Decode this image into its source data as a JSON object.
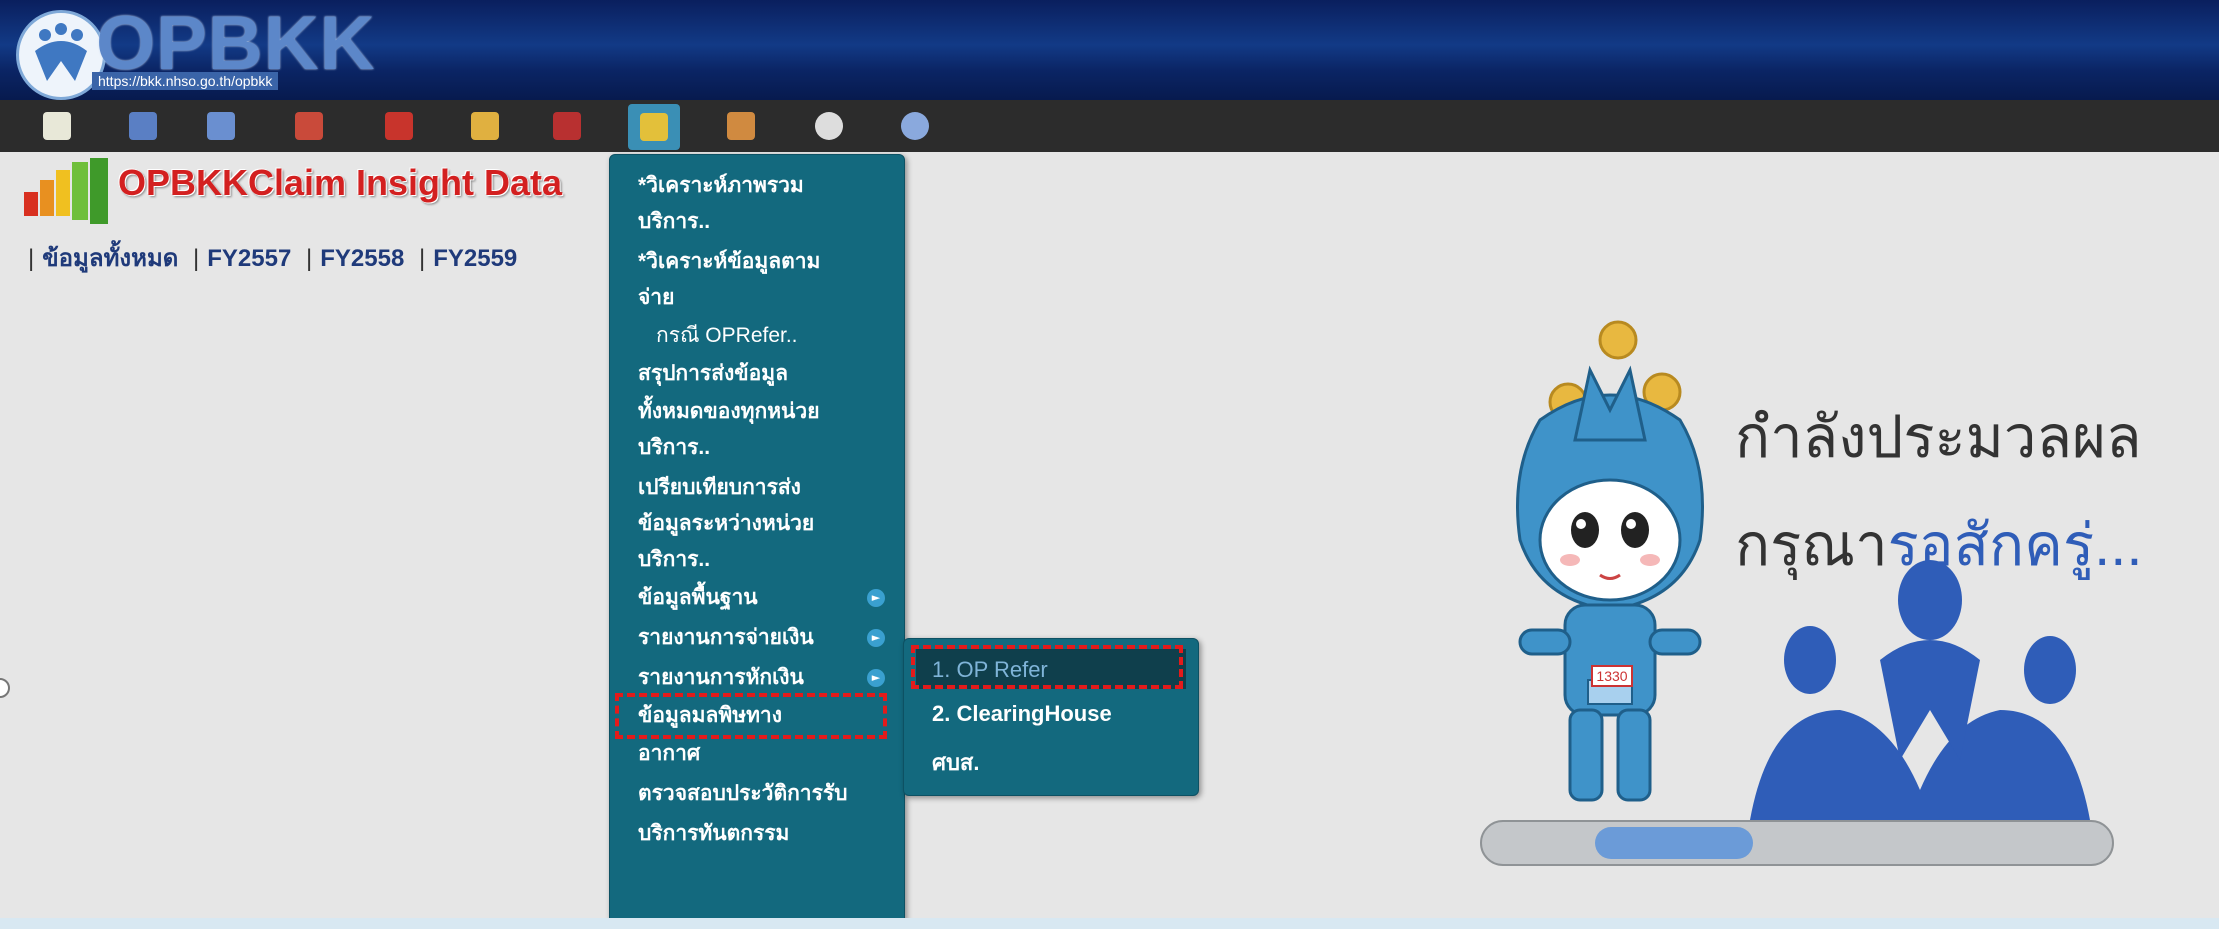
{
  "header": {
    "logo_text": "OPBKK",
    "logo_url": "https://bkk.nhso.go.th/opbkk"
  },
  "toolbar": {
    "icons": [
      {
        "name": "chart-icon",
        "color": "#e8e8d8"
      },
      {
        "name": "document-icon",
        "color": "#5a7fc4"
      },
      {
        "name": "search-icon",
        "color": "#6a8fd0"
      },
      {
        "name": "book-icon",
        "color": "#c94a3a"
      },
      {
        "name": "magnifier-icon",
        "color": "#c8342c"
      },
      {
        "name": "star-icon",
        "color": "#e0b040"
      },
      {
        "name": "box-icon",
        "color": "#b83030"
      },
      {
        "name": "report-icon",
        "color": "#e3c03a"
      },
      {
        "name": "users-icon",
        "color": "#d08a40"
      },
      {
        "name": "gear-icon",
        "color": "#dddddd"
      },
      {
        "name": "power-icon",
        "color": "#8aa9dd"
      }
    ]
  },
  "main": {
    "insight_title": "OPBKKClaim Insight Data",
    "fy_nav": [
      "ข้อมูลทั้งหมด",
      "FY2557",
      "FY2558",
      "FY2559"
    ]
  },
  "menu": {
    "items": [
      {
        "label": "*วิเคราะห์ภาพรวม"
      },
      {
        "label": "บริการ.."
      },
      {
        "label": "*วิเคราะห์ข้อมูลตาม"
      },
      {
        "label": "จ่าย"
      },
      {
        "label": "กรณี OPRefer.."
      },
      {
        "label": "สรุปการส่งข้อมูล"
      },
      {
        "label": "ทั้งหมดของทุกหน่วย"
      },
      {
        "label": "บริการ.."
      },
      {
        "label": "เปรียบเทียบการส่ง"
      },
      {
        "label": "ข้อมูลระหว่างหน่วย"
      },
      {
        "label": "บริการ.."
      },
      {
        "label": "ข้อมูลพื้นฐาน"
      },
      {
        "label": "รายงานการจ่ายเงิน"
      },
      {
        "label": "รายงานการหักเงิน"
      },
      {
        "label": "ข้อมูลมลพิษทาง"
      },
      {
        "label": "อากาศ"
      },
      {
        "label": "ตรวจสอบประวัติการรับ"
      },
      {
        "label": "บริการทันตกรรม"
      }
    ],
    "arrow_glyph": "►"
  },
  "submenu": {
    "items": [
      {
        "label": "1. OP Refer"
      },
      {
        "label": "2. ClearingHouse"
      },
      {
        "label": "ศบส."
      }
    ]
  },
  "loader": {
    "line1": "กำลังประมวลผล",
    "line2_prefix": "กรุณา",
    "line2_highlight": "รอสักครู่...",
    "mascot_badge": "1330",
    "progress_start": 0.18,
    "progress_end": 0.43,
    "colors": {
      "highlight": "#2f5db8",
      "bar_fill": "#6b9bd8"
    }
  }
}
